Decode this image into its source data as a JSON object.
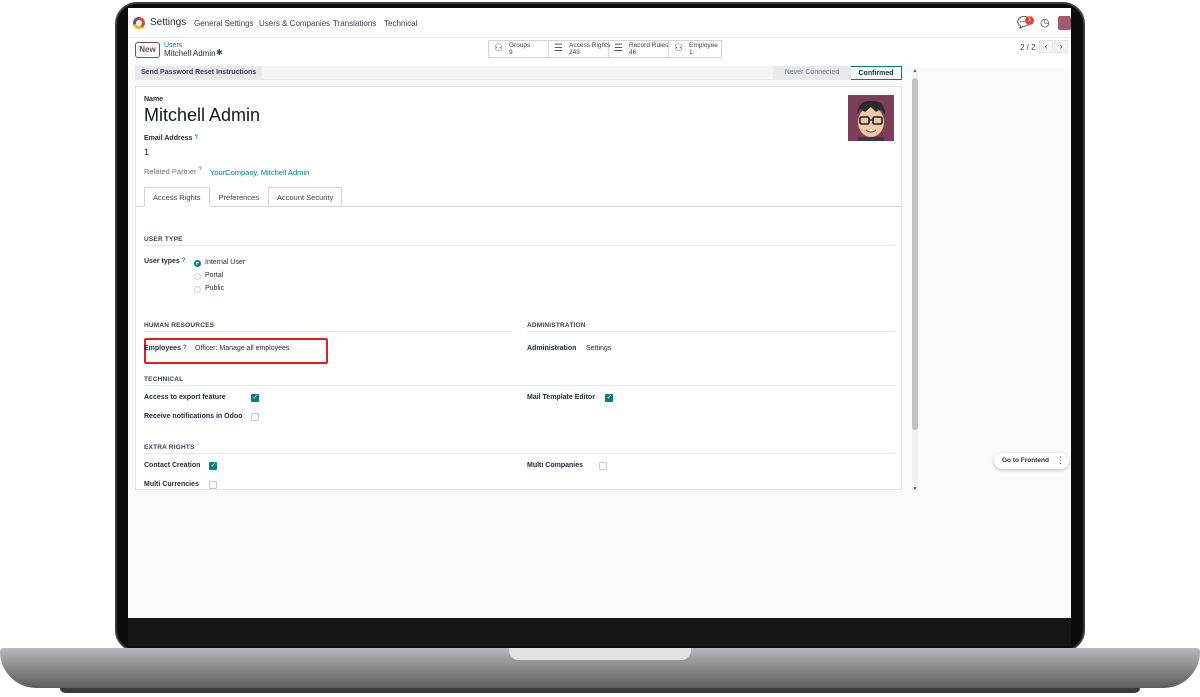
{
  "navbar": {
    "app_name": "Settings",
    "menus": [
      "General Settings",
      "Users & Companies",
      "Translations",
      "Technical"
    ],
    "chat_icon": "chat-icon",
    "notification_count": "1",
    "clock_icon": "clock-icon"
  },
  "control_panel": {
    "new_label": "New",
    "breadcrumb_parent": "Users",
    "breadcrumb_current": "Mitchell Admin",
    "smart_buttons": [
      {
        "icon": "users-icon",
        "label": "Groups",
        "value": "9"
      },
      {
        "icon": "list-icon",
        "label": "Access Rights",
        "value": "243"
      },
      {
        "icon": "list-icon",
        "label": "Record Rules",
        "value": "46"
      },
      {
        "icon": "users-icon",
        "label": "Employee",
        "value": "1"
      }
    ],
    "pager": "2 / 2"
  },
  "statusbar": {
    "reset_button": "Send Password Reset Instructions",
    "stages": [
      "Never Connected",
      "Confirmed"
    ],
    "active_stage": "Confirmed"
  },
  "form": {
    "name_label": "Name",
    "name": "Mitchell Admin",
    "email_label": "Email Address",
    "email": "1",
    "partner_label": "Related Partner",
    "partner": "YourCompany, Mitchell Admin",
    "help_mark": "?",
    "tabs": [
      "Access Rights",
      "Preferences",
      "Account Security"
    ],
    "active_tab": "Access Rights",
    "user_type": {
      "section": "USER TYPE",
      "label": "User types",
      "options": [
        "Internal User",
        "Portal",
        "Public"
      ],
      "selected": "Internal User"
    },
    "human_resources": {
      "section": "HUMAN RESOURCES",
      "employees_label": "Employees",
      "employees_value": "Officer: Manage all employees"
    },
    "administration": {
      "section": "ADMINISTRATION",
      "label": "Administration",
      "value": "Settings"
    },
    "technical": {
      "section": "TECHNICAL",
      "export_label": "Access to export feature",
      "export_checked": true,
      "notifications_label": "Receive notifications in Odoo",
      "notifications_checked": false,
      "mail_template_label": "Mail Template Editor",
      "mail_template_checked": true
    },
    "extra_rights": {
      "section": "EXTRA RIGHTS",
      "contact_label": "Contact Creation",
      "contact_checked": true,
      "multi_currencies_label": "Multi Currencies",
      "multi_currencies_checked": false,
      "multi_companies_label": "Multi Companies",
      "multi_companies_checked": false
    }
  },
  "frontend_button": "Go to Frontend",
  "colors": {
    "accent": "#017e84",
    "brand": "#714b67",
    "highlight": "#e01e26"
  }
}
